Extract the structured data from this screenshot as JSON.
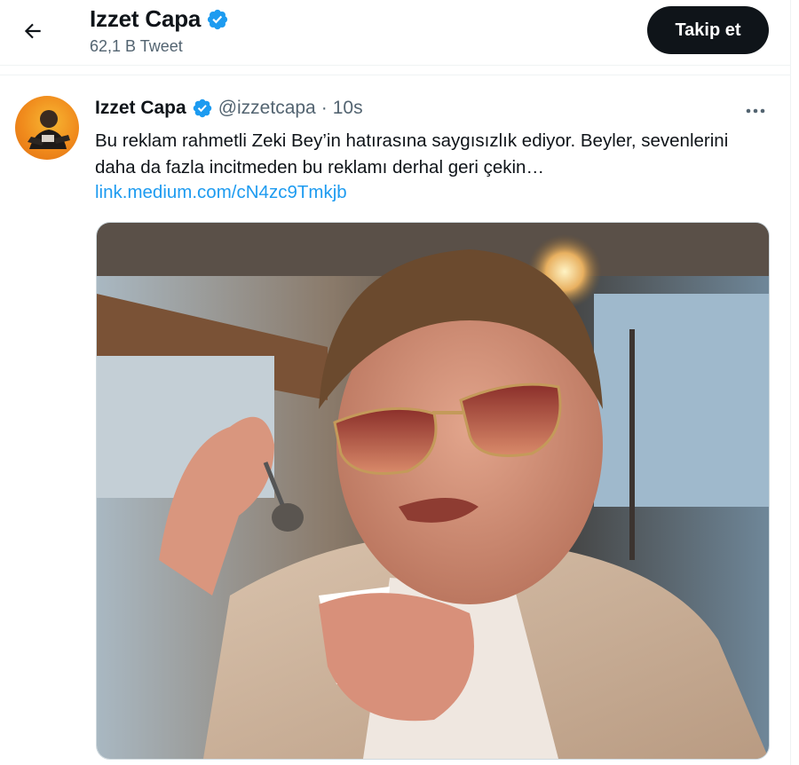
{
  "header": {
    "name": "Izzet Capa",
    "tweet_count": "62,1 B Tweet",
    "follow_label": "Takip et"
  },
  "tweet": {
    "name": "Izzet Capa",
    "handle": "@izzetcapa",
    "separator": "·",
    "time": "10s",
    "text": "Bu reklam rahmetli Zeki Bey’in hatırasına saygısızlık ediyor. Beyler, sevenlerini daha da fazla incitmeden bu reklamı derhal geri çekin…",
    "link": "link.medium.com/cN4zc9Tmkjb"
  },
  "icons": {
    "back": "arrow-left-icon",
    "verified": "verified-badge-icon",
    "more": "more-horizontal-icon"
  },
  "colors": {
    "accent": "#1d9bf0",
    "follow_bg": "#0f1419",
    "secondary_text": "#536471"
  }
}
